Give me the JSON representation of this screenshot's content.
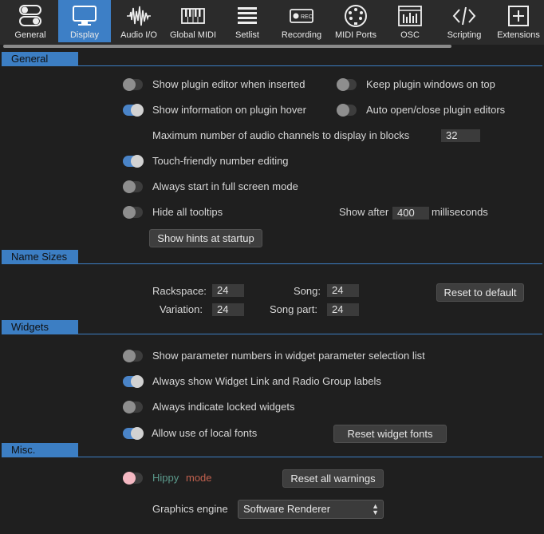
{
  "toolbar": {
    "items": [
      {
        "label": "General",
        "icon": "toggles-icon",
        "active": false
      },
      {
        "label": "Display",
        "icon": "monitor-icon",
        "active": true
      },
      {
        "label": "Audio I/O",
        "icon": "waveform-icon",
        "active": false
      },
      {
        "label": "Global MIDI",
        "icon": "piano-keys-icon",
        "active": false
      },
      {
        "label": "Setlist",
        "icon": "list-icon",
        "active": false
      },
      {
        "label": "Recording",
        "icon": "rec-icon",
        "active": false
      },
      {
        "label": "MIDI Ports",
        "icon": "midi-port-icon",
        "active": false
      },
      {
        "label": "OSC",
        "icon": "osc-icon",
        "active": false
      },
      {
        "label": "Scripting",
        "icon": "code-icon",
        "active": false
      },
      {
        "label": "Extensions",
        "icon": "plus-box-icon",
        "active": false
      }
    ]
  },
  "general": {
    "title": "General",
    "show_plugin_editor": "Show plugin editor when inserted",
    "keep_plugin_windows": "Keep plugin windows on top",
    "show_info_hover": "Show information on plugin hover",
    "auto_open_close": "Auto open/close plugin editors",
    "max_audio_channels_label": "Maximum number of audio channels to display in blocks",
    "max_audio_channels_value": "32",
    "touch_friendly": "Touch-friendly number editing",
    "always_full_screen": "Always start in full screen mode",
    "hide_tooltips": "Hide all tooltips",
    "show_after_label": "Show after",
    "show_after_value": "400",
    "milliseconds_label": "milliseconds",
    "show_hints_button": "Show hints at startup"
  },
  "name_sizes": {
    "title": "Name Sizes",
    "rackspace_label": "Rackspace:",
    "rackspace_value": "24",
    "song_label": "Song:",
    "song_value": "24",
    "variation_label": "Variation:",
    "variation_value": "24",
    "song_part_label": "Song part:",
    "song_part_value": "24",
    "reset_button": "Reset to default"
  },
  "widgets": {
    "title": "Widgets",
    "show_param_numbers": "Show parameter numbers in widget parameter selection list",
    "always_show_link": "Always show Widget Link and Radio Group labels",
    "indicate_locked": "Always indicate locked widgets",
    "allow_local_fonts": "Allow use of local fonts",
    "reset_fonts_button": "Reset widget fonts"
  },
  "misc": {
    "title": "Misc.",
    "hippy_word": "Hippy",
    "mode_word": "mode",
    "reset_warnings_button": "Reset all warnings",
    "graphics_engine_label": "Graphics engine",
    "graphics_engine_value": "Software Renderer"
  },
  "colors": {
    "accent": "#3c7ec3",
    "background": "#1f1f1f",
    "toggle_on": "#4a84c8",
    "hippy": "#5b9a8c",
    "mode": "#c0604e"
  }
}
